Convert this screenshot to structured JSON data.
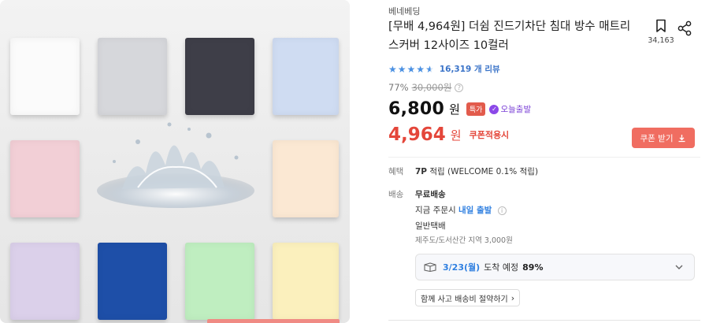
{
  "product": {
    "brand": "베네베딩",
    "title": "[무배 4,964원] 더쉼 진드기차단 침대 방수 매트리스커버 12사이즈 10컬러",
    "bookmark_count": "34,163",
    "rating_stars": 4.5,
    "review_text": "16,319 개 리뷰",
    "discount_pct": "77%",
    "original_price": "30,000원",
    "price": "6,800",
    "price_unit": "원",
    "badge_special": "특가",
    "badge_today": "오늘출발",
    "coupon_price": "4,964",
    "coupon_unit": "원",
    "coupon_label": "쿠폰적용시",
    "coupon_button": "쿠폰 받기"
  },
  "benefit": {
    "label": "혜택",
    "points": "7P",
    "text": "적립 (WELCOME 0.1% 적립)"
  },
  "shipping": {
    "label": "배송",
    "free": "무료배송",
    "order_now": "지금 주문시",
    "next_day": "내일 출발",
    "carrier": "일반택배",
    "extra": "제주도/도서산간 지역 3,000원",
    "delivery_date": "3/23(월)",
    "delivery_mid": "도착 예정",
    "delivery_pct": "89%",
    "bundle_button": "함께 사고 배송비 절약하기"
  },
  "colors": {
    "accent_red": "#e4463a",
    "button_red": "#f06d61",
    "link_blue": "#3a73c8",
    "star_blue": "#4a90e2",
    "today_purple": "#8b48e8"
  },
  "swatches": [
    "#fbfbfb",
    "#d6d7db",
    "#3e3e48",
    "#cfdcf2",
    "#f2cfd6",
    "#fbe8d3",
    "#dbd0ea",
    "#1e4fa8",
    "#bfeec0",
    "#fbf0bd"
  ]
}
